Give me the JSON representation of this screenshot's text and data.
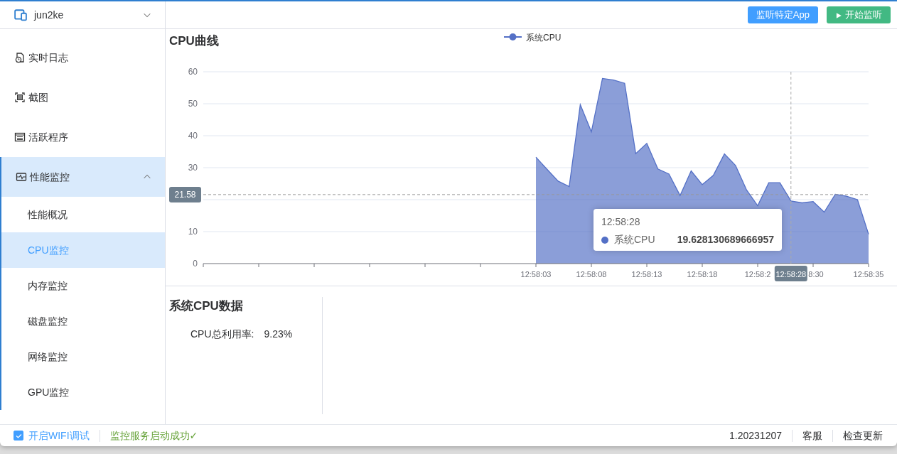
{
  "device_selector": {
    "label": "jun2ke"
  },
  "sidebar": {
    "items": [
      {
        "label": "实时日志",
        "kind": "log",
        "expanded": false,
        "selected": false
      },
      {
        "label": "截图",
        "kind": "screenshot",
        "expanded": false,
        "selected": false
      },
      {
        "label": "活跃程序",
        "kind": "apps",
        "expanded": false,
        "selected": false
      },
      {
        "label": "性能监控",
        "kind": "perf",
        "expanded": true,
        "selected": false,
        "children": [
          {
            "label": "性能概况",
            "selected": false
          },
          {
            "label": "CPU监控",
            "selected": true
          },
          {
            "label": "内存监控",
            "selected": false
          },
          {
            "label": "磁盘监控",
            "selected": false
          },
          {
            "label": "网络监控",
            "selected": false
          },
          {
            "label": "GPU监控",
            "selected": false
          }
        ]
      }
    ]
  },
  "toolbar": {
    "buttons": [
      {
        "label": "监听特定App",
        "kind": "primary"
      },
      {
        "label": "开始监听",
        "kind": "play"
      }
    ]
  },
  "chart_panel": {
    "title": "CPU曲线",
    "chart_data": {
      "type": "area",
      "categories": [
        null,
        null,
        null,
        null,
        null,
        null,
        null,
        null,
        null,
        null,
        null,
        null,
        null,
        null,
        null,
        null,
        null,
        null,
        null,
        null,
        null,
        null,
        null,
        null,
        null,
        null,
        null,
        null,
        null,
        null,
        "12:58:03",
        null,
        null,
        null,
        null,
        "12:58:08",
        null,
        null,
        null,
        null,
        "12:58:13",
        null,
        null,
        null,
        null,
        "12:58:18",
        null,
        null,
        null,
        null,
        "12:58:2",
        null,
        null,
        "12:58:28",
        null,
        "8:30",
        null,
        null,
        null,
        null,
        "12:58:35"
      ],
      "series": [
        {
          "name": "系统CPU",
          "color": "#5470c6",
          "values": [
            null,
            null,
            null,
            null,
            null,
            null,
            null,
            null,
            null,
            null,
            null,
            null,
            null,
            null,
            null,
            null,
            null,
            null,
            null,
            null,
            null,
            null,
            null,
            null,
            null,
            null,
            null,
            null,
            null,
            null,
            33.3,
            29.5,
            25.8,
            24.1,
            49.7,
            41.2,
            57.9,
            57.4,
            56.4,
            34.4,
            37.6,
            29.6,
            28.0,
            21.3,
            29.0,
            24.7,
            27.6,
            34.3,
            30.7,
            23.0,
            18.1,
            25.3,
            25.3,
            19.6,
            19.0,
            19.4,
            16.1,
            21.7,
            21.1,
            20.0,
            9.2
          ]
        }
      ],
      "ylim": [
        0,
        60
      ],
      "yticks": [
        0,
        10,
        30,
        40,
        50,
        60
      ],
      "grid": true,
      "ref_lines": [
        {
          "axis": "y",
          "value": 21.58,
          "label": "21.58"
        }
      ]
    },
    "tooltip": {
      "title": "12:58:28",
      "series": "系统CPU",
      "value": "19.628130689666957"
    }
  },
  "data_panel": {
    "title": "系统CPU数据",
    "rows": [
      {
        "label": "CPU总利用率:",
        "value": "9.23%"
      }
    ]
  },
  "status_bar": {
    "wifi_debug": {
      "label": "开启WIFI调试",
      "checked": true
    },
    "service_status": "监控服务启动成功✓",
    "version": "1.20231207",
    "links": [
      "客服",
      "检查更新"
    ]
  }
}
